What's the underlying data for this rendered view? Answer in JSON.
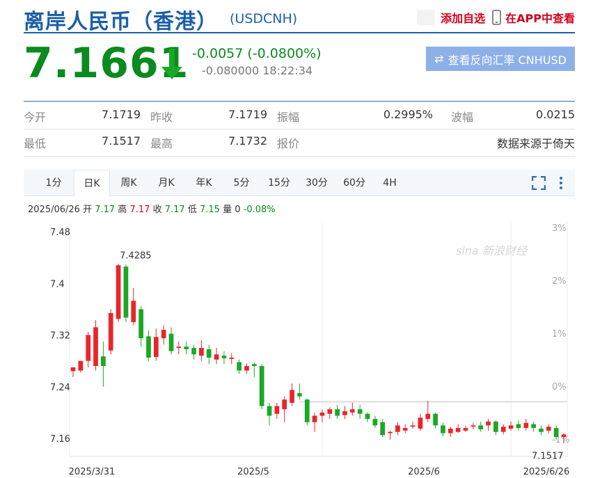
{
  "header": {
    "title": "离岸人民币（香港）",
    "code": "(USDCNH)",
    "add_favorite": "添加自选",
    "app_view": "在APP中查看"
  },
  "price": {
    "current": "7.1661",
    "change": "-0.0057 (-0.0800%)",
    "change_sub": "-0.080000 18:22:34",
    "reverse_button": "查看反向汇率 CNHUSD"
  },
  "stats": {
    "row1": [
      {
        "label": "今开",
        "value": "7.1719"
      },
      {
        "label": "昨收",
        "value": "7.1719"
      },
      {
        "label": "振幅",
        "value": "0.2995%"
      },
      {
        "label": "波幅",
        "value": "0.0215"
      }
    ],
    "row2": [
      {
        "label": "最低",
        "value": "7.1517"
      },
      {
        "label": "最高",
        "value": "7.1732"
      },
      {
        "label": "报价",
        "value": ""
      },
      {
        "label": "",
        "value": "数据来源于倚天"
      }
    ]
  },
  "tabs": [
    "1分",
    "日K",
    "周K",
    "月K",
    "年K",
    "5分",
    "15分",
    "30分",
    "60分",
    "4H"
  ],
  "active_tab": "日K",
  "ohlc": {
    "date": "2025/06/26",
    "open_label": "开",
    "open": "7.17",
    "high_label": "高",
    "high": "7.17",
    "close_label": "收",
    "close": "7.17",
    "low_label": "低",
    "low": "7.15",
    "vol_label": "量",
    "vol": "0",
    "chg": "-0.08%"
  },
  "colors": {
    "up": "#e8262b",
    "down": "#1aa825",
    "brand": "#1d5fa6"
  },
  "chart_data": {
    "type": "candlestick",
    "y_ticks": [
      "7.48",
      "7.4",
      "7.32",
      "7.24",
      "7.16"
    ],
    "y_range": [
      7.13,
      7.48
    ],
    "pct_ticks": [
      "3%",
      "2%",
      "1%",
      "0%",
      "-1%"
    ],
    "x_labels": [
      "2025/3/31",
      "2025/5",
      "2025/6",
      "2025/6/26"
    ],
    "x_label_index": [
      10,
      33,
      58,
      80
    ],
    "max_label": "7.4285",
    "min_label": "7.1517",
    "reference_level": 7.2165,
    "candles": [
      [
        7.264,
        7.27,
        7.268,
        7.255
      ],
      [
        7.265,
        7.28,
        7.277,
        7.262
      ],
      [
        7.28,
        7.32,
        7.325,
        7.27
      ],
      [
        7.272,
        7.332,
        7.343,
        7.265
      ],
      [
        7.287,
        7.272,
        7.31,
        7.24
      ],
      [
        7.296,
        7.354,
        7.36,
        7.29
      ],
      [
        7.345,
        7.428,
        7.43,
        7.34
      ],
      [
        7.426,
        7.347,
        7.429,
        7.34
      ],
      [
        7.34,
        7.373,
        7.393,
        7.335
      ],
      [
        7.36,
        7.315,
        7.365,
        7.302
      ],
      [
        7.318,
        7.285,
        7.327,
        7.28
      ],
      [
        7.286,
        7.317,
        7.33,
        7.28
      ],
      [
        7.315,
        7.328,
        7.335,
        7.305
      ],
      [
        7.322,
        7.295,
        7.332,
        7.29
      ],
      [
        7.3,
        7.302,
        7.31,
        7.29
      ],
      [
        7.302,
        7.298,
        7.31,
        7.29
      ],
      [
        7.3,
        7.29,
        7.305,
        7.282
      ],
      [
        7.288,
        7.3,
        7.312,
        7.28
      ],
      [
        7.298,
        7.285,
        7.305,
        7.275
      ],
      [
        7.282,
        7.29,
        7.3,
        7.275
      ],
      [
        7.288,
        7.284,
        7.295,
        7.275
      ],
      [
        7.283,
        7.285,
        7.292,
        7.275
      ],
      [
        7.278,
        7.265,
        7.282,
        7.26
      ],
      [
        7.265,
        7.272,
        7.276,
        7.26
      ],
      [
        7.275,
        7.272,
        7.278,
        7.255
      ],
      [
        7.272,
        7.21,
        7.275,
        7.205
      ],
      [
        7.21,
        7.195,
        7.215,
        7.18
      ],
      [
        7.198,
        7.21,
        7.215,
        7.19
      ],
      [
        7.205,
        7.22,
        7.225,
        7.185
      ],
      [
        7.215,
        7.235,
        7.245,
        7.21
      ],
      [
        7.23,
        7.225,
        7.245,
        7.22
      ],
      [
        7.22,
        7.185,
        7.222,
        7.18
      ],
      [
        7.185,
        7.195,
        7.2,
        7.17
      ],
      [
        7.195,
        7.2,
        7.205,
        7.185
      ],
      [
        7.198,
        7.205,
        7.208,
        7.19
      ],
      [
        7.205,
        7.195,
        7.212,
        7.19
      ],
      [
        7.196,
        7.202,
        7.21,
        7.19
      ],
      [
        7.2,
        7.205,
        7.215,
        7.195
      ],
      [
        7.205,
        7.198,
        7.212,
        7.19
      ],
      [
        7.198,
        7.19,
        7.2,
        7.185
      ],
      [
        7.19,
        7.18,
        7.195,
        7.176
      ],
      [
        7.185,
        7.165,
        7.19,
        7.162
      ],
      [
        7.168,
        7.17,
        7.172,
        7.158
      ],
      [
        7.17,
        7.18,
        7.185,
        7.165
      ],
      [
        7.172,
        7.176,
        7.182,
        7.168
      ],
      [
        7.178,
        7.18,
        7.186,
        7.175
      ],
      [
        7.175,
        7.192,
        7.198,
        7.172
      ],
      [
        7.19,
        7.198,
        7.218,
        7.185
      ],
      [
        7.198,
        7.18,
        7.2,
        7.175
      ],
      [
        7.18,
        7.168,
        7.184,
        7.163
      ],
      [
        7.168,
        7.175,
        7.178,
        7.162
      ],
      [
        7.17,
        7.176,
        7.182,
        7.168
      ],
      [
        7.172,
        7.176,
        7.18,
        7.17
      ],
      [
        7.178,
        7.18,
        7.184,
        7.174
      ],
      [
        7.18,
        7.174,
        7.186,
        7.17
      ],
      [
        7.18,
        7.186,
        7.19,
        7.172
      ],
      [
        7.186,
        7.17,
        7.188,
        7.165
      ],
      [
        7.17,
        7.178,
        7.182,
        7.166
      ],
      [
        7.175,
        7.18,
        7.186,
        7.172
      ],
      [
        7.182,
        7.176,
        7.188,
        7.172
      ],
      [
        7.176,
        7.184,
        7.19,
        7.172
      ],
      [
        7.182,
        7.176,
        7.186,
        7.17
      ],
      [
        7.175,
        7.17,
        7.18,
        7.165
      ],
      [
        7.172,
        7.178,
        7.182,
        7.168
      ],
      [
        7.176,
        7.162,
        7.18,
        7.158
      ],
      [
        7.162,
        7.166,
        7.168,
        7.152
      ]
    ]
  }
}
